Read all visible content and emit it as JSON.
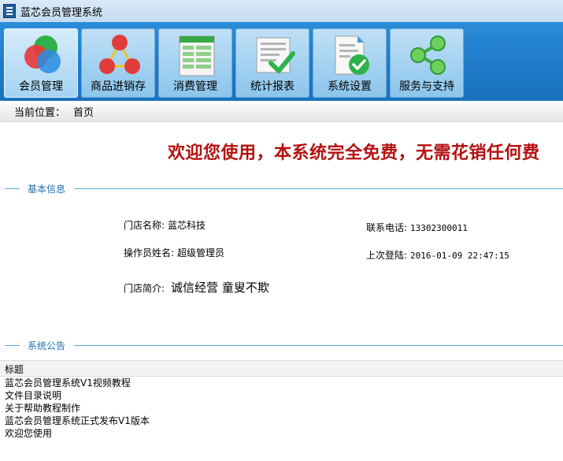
{
  "window": {
    "title": "蓝芯会员管理系统"
  },
  "toolbar": {
    "items": [
      {
        "label": "会员管理",
        "icon": "members-circles-icon"
      },
      {
        "label": "商品进销存",
        "icon": "nodes-triangle-icon"
      },
      {
        "label": "消费管理",
        "icon": "spreadsheet-icon"
      },
      {
        "label": "统计报表",
        "icon": "report-check-icon"
      },
      {
        "label": "系统设置",
        "icon": "document-check-icon"
      },
      {
        "label": "服务与支持",
        "icon": "share-icon"
      }
    ]
  },
  "breadcrumb": {
    "label": "当前位置：",
    "current": "首页"
  },
  "welcome": "欢迎您使用，本系统完全免费，无需花销任何费",
  "basic_info": {
    "section_title": "基本信息",
    "store_name_label": "门店名称:",
    "store_name": "蓝芯科技",
    "operator_label": "操作员姓名:",
    "operator": "超级管理员",
    "phone_label": "联系电话:",
    "phone": "13302300011",
    "last_login_label": "上次登陆:",
    "last_login": "2016-01-09 22:47:15",
    "intro_label": "门店简介:",
    "intro": "诚信经营 童叟不欺"
  },
  "announcements": {
    "section_title": "系统公告",
    "column_header": "标题",
    "items": [
      "蓝芯会员管理系统V1视频教程",
      "文件目录说明",
      "关于帮助教程制作",
      "蓝芯会员管理系统正式发布V1版本",
      "欢迎您使用"
    ]
  },
  "colors": {
    "toolbar_bg": "#1d7ac8",
    "welcome_text": "#b51111",
    "section_accent": "#4fb0d9"
  }
}
